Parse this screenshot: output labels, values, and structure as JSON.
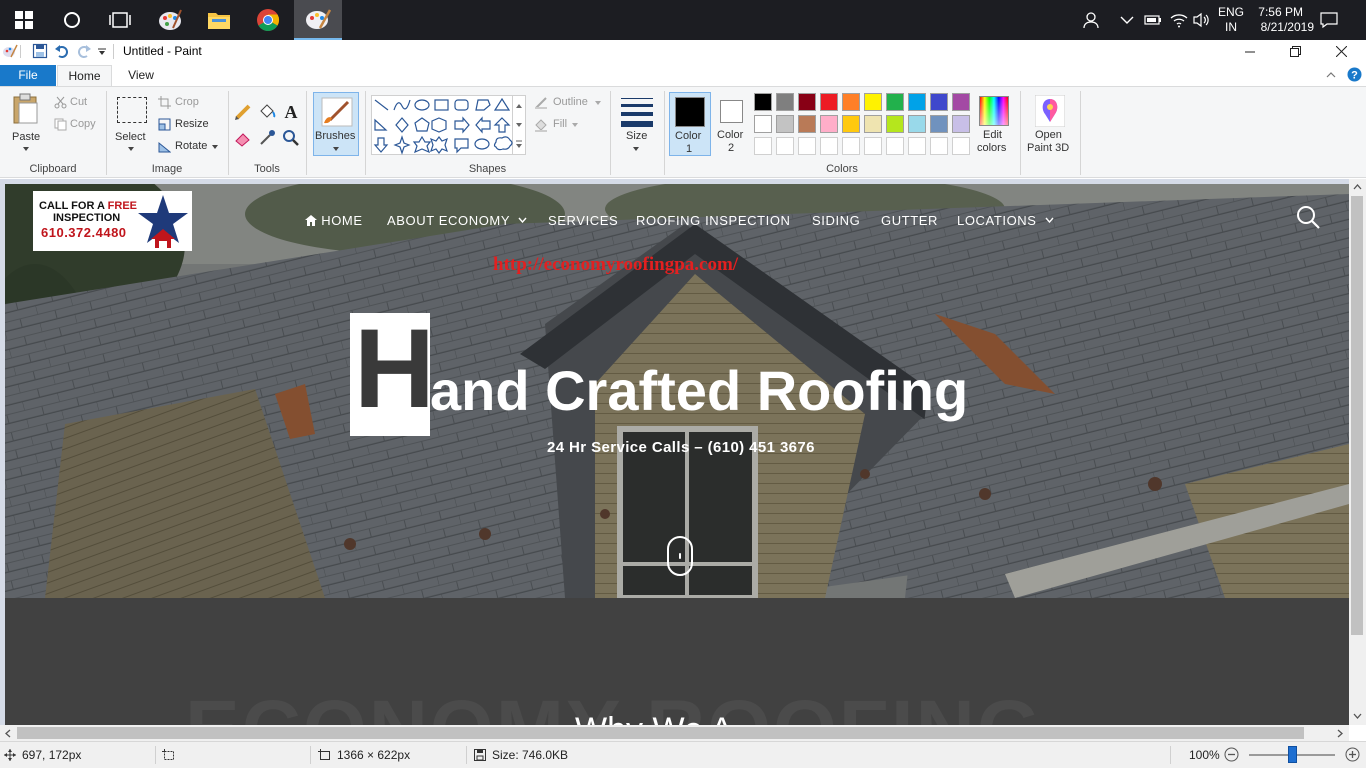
{
  "taskbar": {
    "lang_top": "ENG",
    "lang_bottom": "IN",
    "time": "7:56 PM",
    "date": "8/21/2019"
  },
  "titlebar": {
    "title": "Untitled - Paint"
  },
  "tabs": {
    "file": "File",
    "home": "Home",
    "view": "View"
  },
  "ribbon": {
    "clipboard": {
      "paste": "Paste",
      "cut": "Cut",
      "copy": "Copy",
      "label": "Clipboard"
    },
    "image": {
      "select": "Select",
      "crop": "Crop",
      "resize": "Resize",
      "rotate": "Rotate",
      "label": "Image"
    },
    "tools": {
      "label": "Tools"
    },
    "brushes": {
      "label": "Brushes"
    },
    "shapes": {
      "outline": "Outline",
      "fill": "Fill",
      "label": "Shapes"
    },
    "size": {
      "label": "Size"
    },
    "colors": {
      "color1_l1": "Color",
      "color1_l2": "1",
      "color2_l1": "Color",
      "color2_l2": "2",
      "edit_l1": "Edit",
      "edit_l2": "colors",
      "label": "Colors",
      "palette_row1": [
        "#000000",
        "#7f7f7f",
        "#880015",
        "#ed1c24",
        "#ff7f27",
        "#fff200",
        "#22b14c",
        "#00a2e8",
        "#3f48cc",
        "#a349a4"
      ],
      "palette_row2": [
        "#ffffff",
        "#c3c3c3",
        "#b97a57",
        "#ffaec9",
        "#ffc90e",
        "#efe4b0",
        "#b5e61d",
        "#99d9ea",
        "#7092be",
        "#c8bfe7"
      ]
    },
    "paint3d": {
      "l1": "Open",
      "l2": "Paint 3D"
    }
  },
  "website": {
    "logo": {
      "line1a": "CALL FOR A ",
      "line1b": "FREE",
      "line2": "INSPECTION",
      "phone": "610.372.4480"
    },
    "nav": {
      "home": "HOME",
      "about": "ABOUT ECONOMY",
      "services": "SERVICES",
      "inspection": "ROOFING INSPECTION",
      "siding": "SIDING",
      "gutter": "GUTTER",
      "locations": "LOCATIONS"
    },
    "url": "http://economyroofingpa.com/",
    "hero_initial": "H",
    "hero_rest": "and Crafted Roofing",
    "subtitle": "24 Hr Service Calls – (610) 451 3676",
    "bg_text": "ECONOMY ROOFING",
    "section_title": "Why We A"
  },
  "status": {
    "cursor": "697, 172px",
    "dims": "1366 × 622px",
    "size": "Size: 746.0KB",
    "zoom": "100%"
  }
}
